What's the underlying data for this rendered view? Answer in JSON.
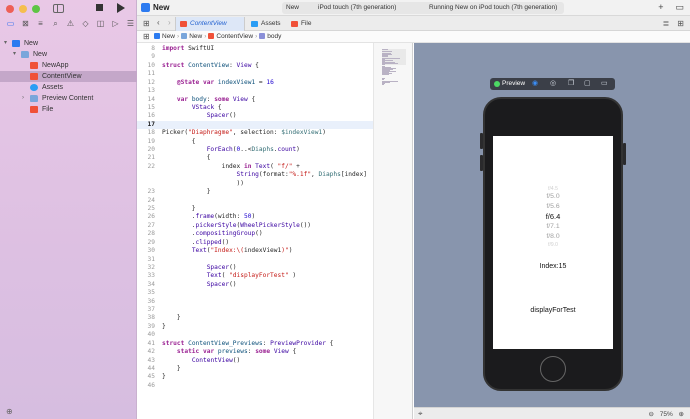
{
  "window": {
    "title": "New"
  },
  "toolbar": {
    "scheme_project": "New",
    "scheme_device": "iPod touch (7th generation)",
    "status": "Running New on iPod touch (7th generation)",
    "add_label": "+",
    "split_label": "▭"
  },
  "tabs": [
    {
      "label": "ContentView",
      "icon": "swift-file-icon",
      "active": true
    },
    {
      "label": "Assets",
      "icon": "assets-icon",
      "active": false
    },
    {
      "label": "File",
      "icon": "swift-file-icon",
      "active": false
    }
  ],
  "breadcrumb": [
    "New",
    "New",
    "ContentView",
    "body"
  ],
  "navigator": {
    "items": [
      {
        "label": "New",
        "icon": "app-icon",
        "indent": 0,
        "chevron": "▾"
      },
      {
        "label": "New",
        "icon": "folder-icon",
        "indent": 1,
        "chevron": "▾"
      },
      {
        "label": "NewApp",
        "icon": "swift-file-icon",
        "indent": 2,
        "chevron": ""
      },
      {
        "label": "ContentView",
        "icon": "swift-file-icon",
        "indent": 2,
        "chevron": "",
        "selected": true
      },
      {
        "label": "Assets",
        "icon": "assets-icon",
        "indent": 2,
        "chevron": ""
      },
      {
        "label": "Preview Content",
        "icon": "folder-icon",
        "indent": 2,
        "chevron": "›"
      },
      {
        "label": "File",
        "icon": "swift-file-icon",
        "indent": 2,
        "chevron": ""
      }
    ]
  },
  "code": [
    {
      "n": "8",
      "html": "<span class='kw'>import</span> SwiftUI"
    },
    {
      "n": "9",
      "html": ""
    },
    {
      "n": "10",
      "html": "<span class='kw'>struct</span> <span class='ty'>ContentView</span>: <span class='pr'>View</span> {"
    },
    {
      "n": "11",
      "html": ""
    },
    {
      "n": "12",
      "html": "    <span class='kw'>@State</span> <span class='kw'>var</span> <span class='ty'>indexView1</span> = <span class='nu'>16</span>"
    },
    {
      "n": "13",
      "html": ""
    },
    {
      "n": "14",
      "html": "    <span class='kw'>var</span> <span class='ty'>body</span>: <span class='kw'>some</span> <span class='pr'>View</span> {"
    },
    {
      "n": "15",
      "html": "        <span class='pr'>VStack</span> {"
    },
    {
      "n": "16",
      "html": "            <span class='pr'>Spacer</span>()"
    },
    {
      "n": "17",
      "html": "",
      "current": true
    },
    {
      "n": "18",
      "html": "Picker(<span class='st'>\"Diaphragme\"</span>, selection: <span class='fn'>$indexView1</span>)"
    },
    {
      "n": "19",
      "html": "        {"
    },
    {
      "n": "20",
      "html": "            <span class='pr'>ForEach</span>(<span class='nu'>0</span>..&lt;<span class='fn'>Diaphs</span>.<span class='pr'>count</span>)"
    },
    {
      "n": "21",
      "html": "            {"
    },
    {
      "n": "22",
      "html": "                index <span class='kw'>in</span> <span class='pr'>Text</span>( <span class='st'>\"f/\"</span> +"
    },
    {
      "n": "",
      "html": "                    <span class='pr'>String</span>(format:<span class='st'>\"%.1f\"</span>, <span class='fn'>Diaphs</span>[index]"
    },
    {
      "n": "",
      "html": "                    ))"
    },
    {
      "n": "23",
      "html": "            }"
    },
    {
      "n": "24",
      "html": ""
    },
    {
      "n": "25",
      "html": "        }"
    },
    {
      "n": "26",
      "html": "        .<span class='pr'>frame</span>(width: <span class='nu'>50</span>)"
    },
    {
      "n": "27",
      "html": "        .<span class='pr'>pickerStyle</span>(<span class='pr'>WheelPickerStyle</span>())"
    },
    {
      "n": "28",
      "html": "        .<span class='pr'>compositingGroup</span>()"
    },
    {
      "n": "29",
      "html": "        .<span class='pr'>clipped</span>()"
    },
    {
      "n": "30",
      "html": "        <span class='pr'>Text</span>(<span class='st'>\"Index:\\(</span>indexView1<span class='st'>)\"</span>)"
    },
    {
      "n": "31",
      "html": ""
    },
    {
      "n": "32",
      "html": "            <span class='pr'>Spacer</span>()"
    },
    {
      "n": "33",
      "html": "            <span class='pr'>Text</span>( <span class='st'>\"displayForTest\"</span> )"
    },
    {
      "n": "34",
      "html": "            <span class='pr'>Spacer</span>()"
    },
    {
      "n": "35",
      "html": ""
    },
    {
      "n": "36",
      "html": ""
    },
    {
      "n": "37",
      "html": ""
    },
    {
      "n": "38",
      "html": "    }"
    },
    {
      "n": "39",
      "html": "}"
    },
    {
      "n": "40",
      "html": ""
    },
    {
      "n": "41",
      "html": "<span class='kw'>struct</span> <span class='ty'>ContentView_Previews</span>: <span class='pr'>PreviewProvider</span> {"
    },
    {
      "n": "42",
      "html": "    <span class='kw'>static</span> <span class='kw'>var</span> <span class='ty'>previews</span>: <span class='kw'>some</span> <span class='pr'>View</span> {"
    },
    {
      "n": "43",
      "html": "        <span class='pr'>ContentView</span>()"
    },
    {
      "n": "44",
      "html": "    }"
    },
    {
      "n": "45",
      "html": "}"
    },
    {
      "n": "46",
      "html": ""
    }
  ],
  "preview": {
    "label": "Preview",
    "picker_items": [
      {
        "text": "f/4.5",
        "style": "faint"
      },
      {
        "text": "f/5.0",
        "style": "mid"
      },
      {
        "text": "f/5.6",
        "style": "mid"
      },
      {
        "text": "f/6.4",
        "style": "sel"
      },
      {
        "text": "f/7.1",
        "style": "mid"
      },
      {
        "text": "f/8.0",
        "style": "mid"
      },
      {
        "text": "f/9.0",
        "style": "faint"
      }
    ],
    "index_label": "Index:15",
    "display_label": "displayForTest"
  },
  "canvas_footer": {
    "zoom": "75%"
  },
  "colors": {
    "accent": "#2a6cf0",
    "canvas": "#8895ad",
    "sidebar": "#e4c5e4"
  }
}
